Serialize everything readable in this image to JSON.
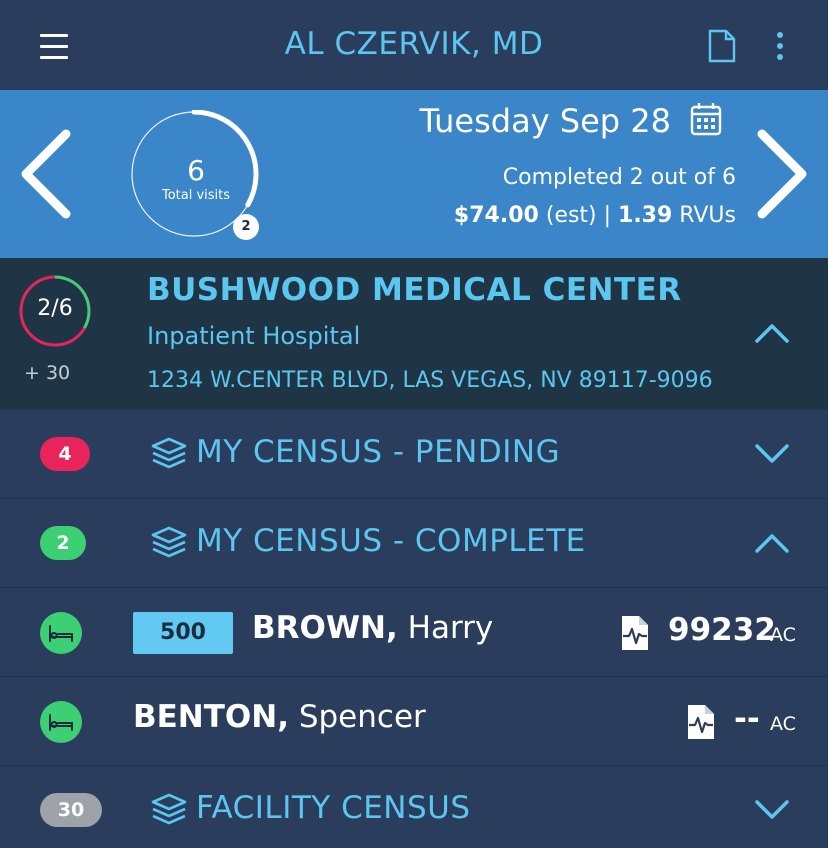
{
  "header": {
    "title": "AL CZERVIK, MD",
    "menu_icon": "menu-icon",
    "doc_icon": "document-icon",
    "more_icon": "more-vertical-icon",
    "accent": "#5bc6f0"
  },
  "summary": {
    "total_visits": "6",
    "total_visits_label": "Total visits",
    "completed_badge": "2",
    "completed_fraction": 0.333,
    "date": "Tuesday Sep 28",
    "completed_text": "Completed 2 out of 6",
    "amount": "$74.00",
    "amount_suffix": " (est) | ",
    "rvus_value": "1.39",
    "rvus_label": " RVUs",
    "background": "#3a86c8"
  },
  "facility": {
    "ratio": "2/6",
    "extra": "+ 30",
    "name": "BUSHWOOD MEDICAL CENTER",
    "type": "Inpatient Hospital",
    "address": "1234 W.CENTER BLVD, LAS VEGAS, NV 89117-9096"
  },
  "sections": {
    "pending": {
      "count": "4",
      "title": "MY CENSUS - PENDING",
      "color": "#e8245a"
    },
    "complete": {
      "count": "2",
      "title": "MY CENSUS - COMPLETE",
      "color": "#3ccf73"
    },
    "facility": {
      "count": "30",
      "title": "FACILITY CENSUS",
      "color": "#9ea3aa"
    }
  },
  "patients": [
    {
      "room": "500",
      "last": "BROWN,",
      "first": " Harry",
      "code": "99232",
      "suffix": "AC"
    },
    {
      "room": "",
      "last": "BENTON,",
      "first": " Spencer",
      "code": "--",
      "suffix": "AC"
    }
  ]
}
